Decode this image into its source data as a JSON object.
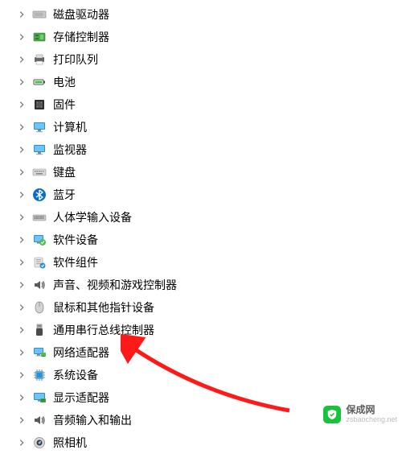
{
  "items": [
    {
      "id": "disk-drives",
      "icon": "hdd",
      "label": "磁盘驱动器"
    },
    {
      "id": "storage-controllers",
      "icon": "storage-controller",
      "label": "存储控制器"
    },
    {
      "id": "print-queues",
      "icon": "printer",
      "label": "打印队列"
    },
    {
      "id": "batteries",
      "icon": "battery",
      "label": "电池"
    },
    {
      "id": "firmware",
      "icon": "firmware",
      "label": "固件"
    },
    {
      "id": "computer",
      "icon": "monitor",
      "label": "计算机"
    },
    {
      "id": "monitors",
      "icon": "monitor",
      "label": "监视器"
    },
    {
      "id": "keyboards",
      "icon": "keyboard",
      "label": "键盘"
    },
    {
      "id": "bluetooth",
      "icon": "bluetooth",
      "label": "蓝牙"
    },
    {
      "id": "hid",
      "icon": "hid",
      "label": "人体学输入设备"
    },
    {
      "id": "software-devices",
      "icon": "software-device",
      "label": "软件设备"
    },
    {
      "id": "software-components",
      "icon": "software-component",
      "label": "软件组件"
    },
    {
      "id": "sound-video-game",
      "icon": "audio",
      "label": "声音、视频和游戏控制器"
    },
    {
      "id": "mouse-pointer",
      "icon": "mouse",
      "label": "鼠标和其他指针设备"
    },
    {
      "id": "usb-controllers",
      "icon": "usb",
      "label": "通用串行总线控制器"
    },
    {
      "id": "network-adapters",
      "icon": "network",
      "label": "网络适配器"
    },
    {
      "id": "system-devices",
      "icon": "chip",
      "label": "系统设备"
    },
    {
      "id": "display-adapters",
      "icon": "display-adapter",
      "label": "显示适配器"
    },
    {
      "id": "audio-io",
      "icon": "audio",
      "label": "音频输入和输出"
    },
    {
      "id": "cameras",
      "icon": "camera",
      "label": "照相机"
    }
  ],
  "watermark": {
    "brand": "保成网",
    "url": "zsbaocheng.net"
  }
}
